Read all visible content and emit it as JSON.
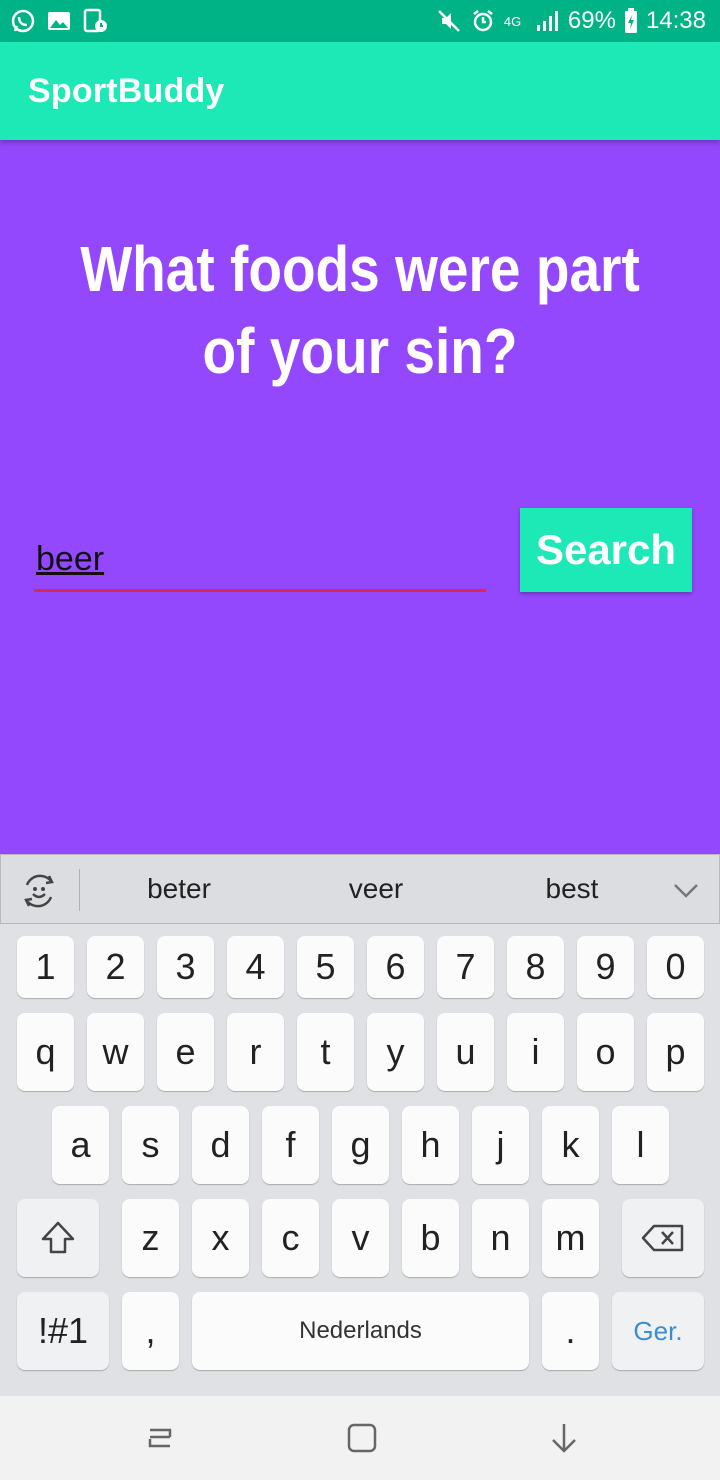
{
  "status_bar": {
    "left_icons": [
      "whatsapp-icon",
      "gallery-icon",
      "screenshot-icon"
    ],
    "network": "4G",
    "battery": "69%",
    "time": "14:38"
  },
  "app_bar": {
    "title": "SportBuddy"
  },
  "main": {
    "question": "What foods were part of your sin?",
    "search_input_value": "beer",
    "search_button_label": "Search"
  },
  "keyboard": {
    "suggestions": [
      "beter",
      "veer",
      "best"
    ],
    "number_row": [
      "1",
      "2",
      "3",
      "4",
      "5",
      "6",
      "7",
      "8",
      "9",
      "0"
    ],
    "row1": [
      "q",
      "w",
      "e",
      "r",
      "t",
      "y",
      "u",
      "i",
      "o",
      "p"
    ],
    "row2": [
      "a",
      "s",
      "d",
      "f",
      "g",
      "h",
      "j",
      "k",
      "l"
    ],
    "row3": [
      "z",
      "x",
      "c",
      "v",
      "b",
      "n",
      "m"
    ],
    "symbols_label": "!#1",
    "comma_label": ",",
    "space_label": "Nederlands",
    "period_label": ".",
    "enter_label": "Ger."
  },
  "colors": {
    "status_bar": "#00b386",
    "app_bar": "#1de9b6",
    "background": "#9448fe",
    "input_underline": "#e0245e"
  }
}
